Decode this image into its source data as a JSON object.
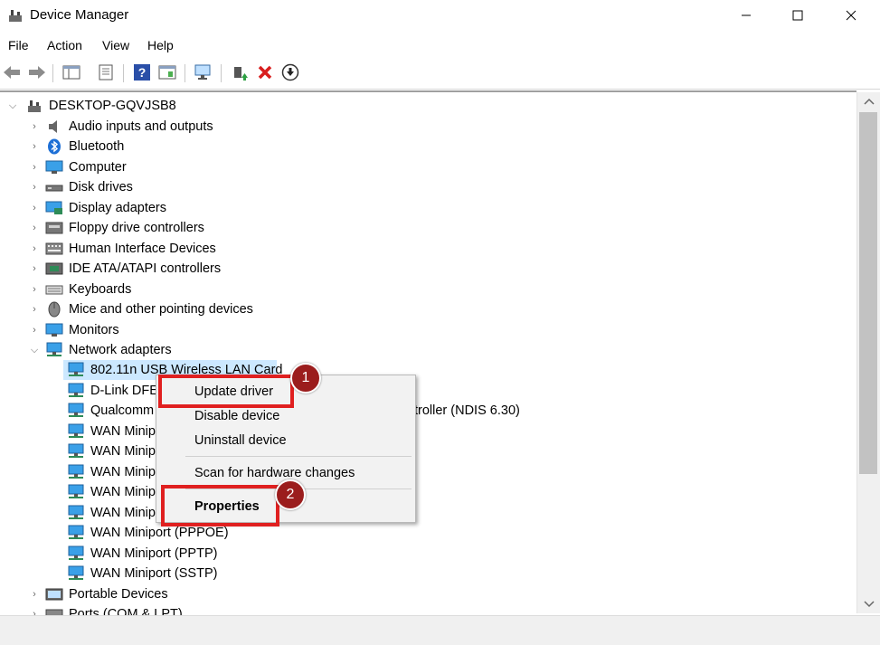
{
  "window": {
    "title": "Device Manager",
    "controls": {
      "minimize": "—",
      "maximize": "☐",
      "close": "✕"
    }
  },
  "menu": [
    "File",
    "Action",
    "View",
    "Help"
  ],
  "toolbar": [
    "back-icon",
    "forward-icon",
    "show-hide-console-tree-icon",
    "properties-icon",
    "help-icon",
    "action-pane-icon",
    "monitor-icon",
    "update-driver-icon",
    "uninstall-icon",
    "download-icon"
  ],
  "tree": {
    "root": "DESKTOP-GQVJSB8",
    "categories": [
      "Audio inputs and outputs",
      "Bluetooth",
      "Computer",
      "Disk drives",
      "Display adapters",
      "Floppy drive controllers",
      "Human Interface Devices",
      "IDE ATA/ATAPI controllers",
      "Keyboards",
      "Mice and other pointing devices",
      "Monitors",
      "Network adapters"
    ],
    "network_children": [
      "802.11n USB Wireless LAN Card",
      "D-Link DFE",
      "Qualcomm",
      "WAN Minip",
      "WAN Minip",
      "WAN Minip",
      "WAN Minip",
      "WAN Minip",
      "WAN Miniport (PPPOE)",
      "WAN Miniport (PPTP)",
      "WAN Miniport (SSTP)"
    ],
    "qualcomm_suffix": "troller (NDIS 6.30)",
    "after": [
      "Portable Devices",
      "Ports (COM & LPT)"
    ]
  },
  "context_menu": {
    "items": [
      "Update driver",
      "Disable device",
      "Uninstall device",
      "Scan for hardware changes",
      "Properties"
    ]
  },
  "annotations": {
    "badge1": "1",
    "badge2": "2",
    "highlight_color": "#e02020",
    "badge_color": "#9b1d1d"
  }
}
